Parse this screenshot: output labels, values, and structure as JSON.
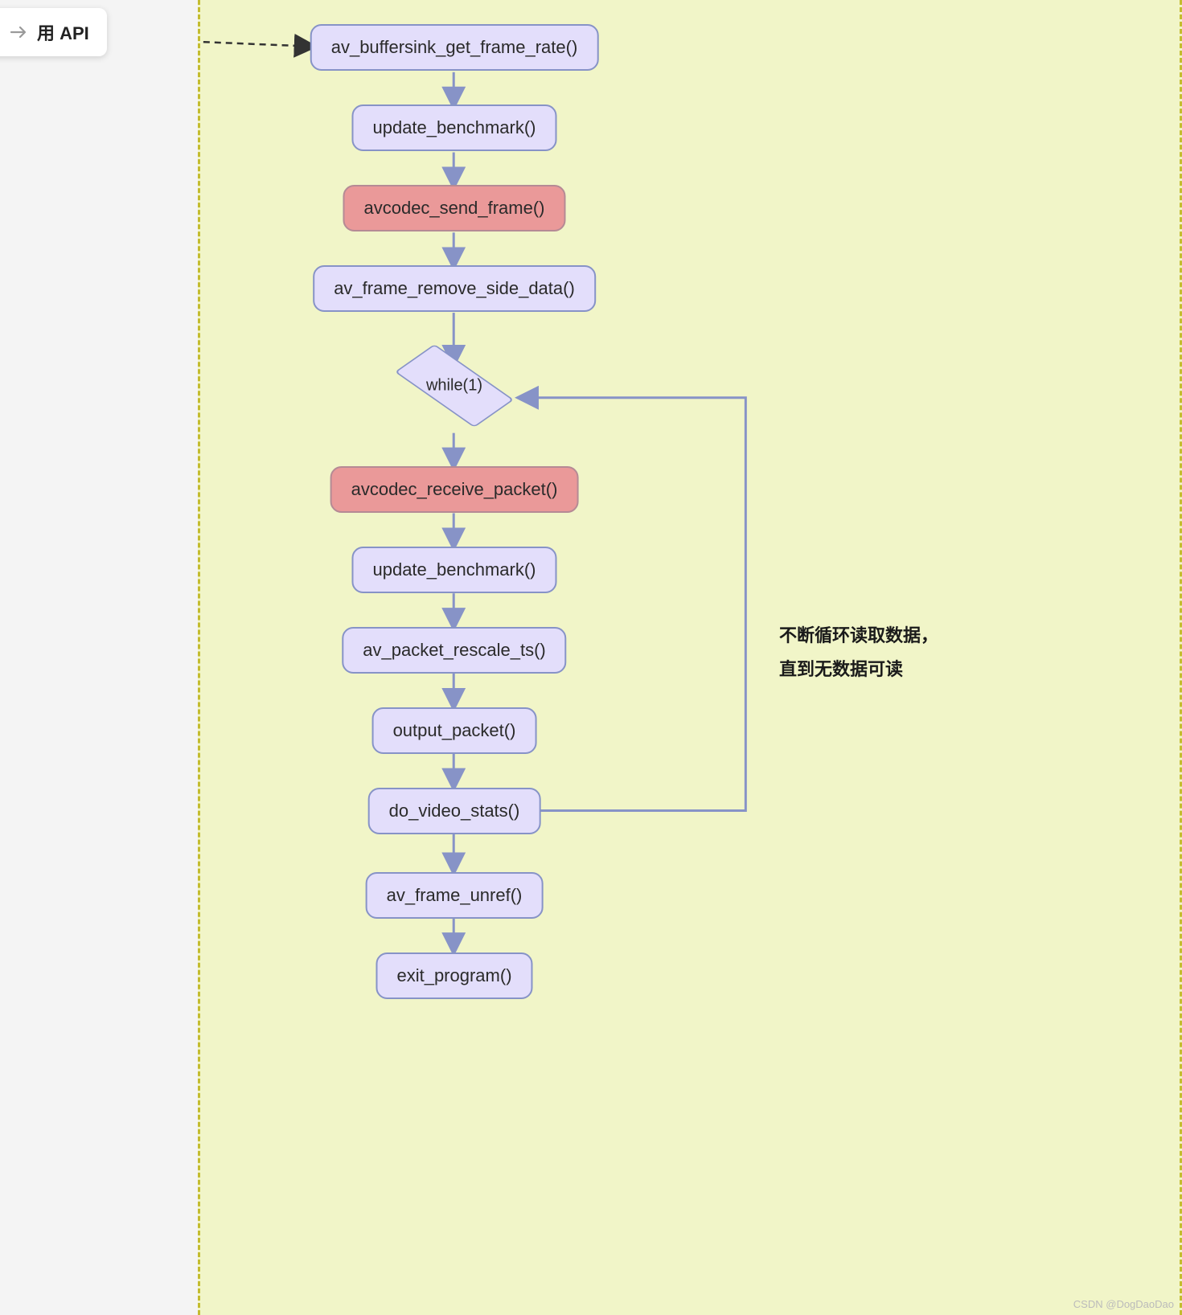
{
  "header": {
    "api_label": "用 API"
  },
  "nodes": {
    "n1": "av_buffersink_get_frame_rate()",
    "n2": "update_benchmark()",
    "n3": "avcodec_send_frame()",
    "n4": "av_frame_remove_side_data()",
    "while": "while(1)",
    "n5": "avcodec_receive_packet()",
    "n6": "update_benchmark()",
    "n7": "av_packet_rescale_ts()",
    "n8": "output_packet()",
    "n9": "do_video_stats()",
    "n10": "av_frame_unref()",
    "n11": "exit_program()"
  },
  "loop_annotation": {
    "line1": "不断循环读取数据，",
    "line2": "直到无数据可读"
  },
  "watermark": "CSDN @DogDaoDao"
}
